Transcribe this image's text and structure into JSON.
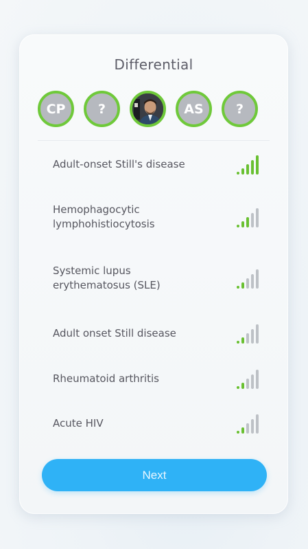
{
  "title": "Differential",
  "avatars": [
    {
      "label": "CP",
      "type": "initials"
    },
    {
      "label": "?",
      "type": "unknown"
    },
    {
      "label": "",
      "type": "photo"
    },
    {
      "label": "AS",
      "type": "initials"
    },
    {
      "label": "?",
      "type": "unknown"
    }
  ],
  "differentials": [
    {
      "label": "Adult-onset Still's disease",
      "strength": 5
    },
    {
      "label": "Hemophagocytic lymphohistiocytosis",
      "strength": 3
    },
    {
      "label": "Systemic lupus erythematosus (SLE)",
      "strength": 2
    },
    {
      "label": "Adult onset Still disease",
      "strength": 2
    },
    {
      "label": "Rheumatoid arthritis",
      "strength": 2
    },
    {
      "label": "Acute HIV",
      "strength": 2
    }
  ],
  "strength_max": 5,
  "next_button": {
    "label": "Next"
  },
  "colors": {
    "accent_green": "#69c031",
    "inactive_bar": "#bdc1c6",
    "button_blue": "#2fb2f6",
    "avatar_gray": "#b6b9bf"
  }
}
